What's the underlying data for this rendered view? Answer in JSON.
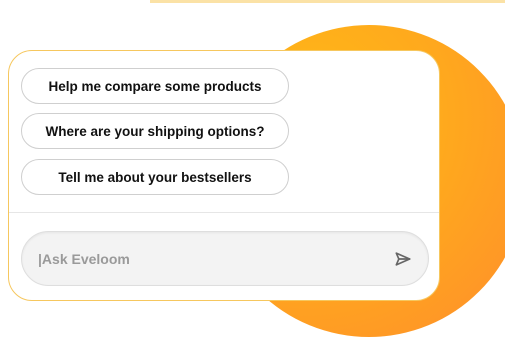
{
  "chat": {
    "suggestions": [
      {
        "label": "Help me compare some products"
      },
      {
        "label": "Where are your shipping options?"
      },
      {
        "label": "Tell me about your bestsellers"
      }
    ],
    "input": {
      "placeholder": "|Ask Eveloom",
      "value": ""
    }
  },
  "icons": {
    "send": "send-arrow-icon"
  },
  "colors": {
    "accent_orange": "#ffa91d",
    "panel_border": "#f6c75e",
    "top_accent": "#fbe2a6"
  }
}
